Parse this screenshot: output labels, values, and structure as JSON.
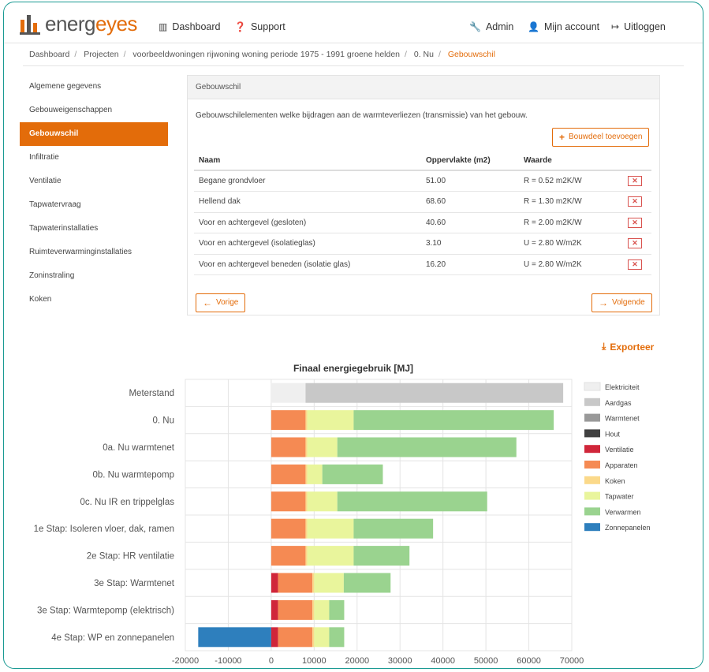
{
  "nav": {
    "logo_part1": "energ",
    "logo_part2": "eyes",
    "dashboard": "Dashboard",
    "support": "Support",
    "admin": "Admin",
    "account": "Mijn account",
    "logout": "Uitloggen"
  },
  "breadcrumb": {
    "items": [
      "Dashboard",
      "Projecten",
      "voorbeeldwoningen rijwoning woning periode 1975 - 1991 groene helden",
      "0. Nu"
    ],
    "active": "Gebouwschil"
  },
  "sidebar": {
    "items": [
      {
        "label": "Algemene gegevens"
      },
      {
        "label": "Gebouweigenschappen"
      },
      {
        "label": "Gebouwschil",
        "active": true
      },
      {
        "label": "Infiltratie"
      },
      {
        "label": "Ventilatie"
      },
      {
        "label": "Tapwatervraag"
      },
      {
        "label": "Tapwaterinstallaties"
      },
      {
        "label": "Ruimteverwarminginstallaties"
      },
      {
        "label": "Zoninstraling"
      },
      {
        "label": "Koken"
      }
    ]
  },
  "panel": {
    "title": "Gebouwschil",
    "description": "Gebouwschilelementen welke bijdragen aan de warmteverliezen (transmissie) van het gebouw.",
    "add_button": "Bouwdeel toevoegen",
    "columns": [
      "Naam",
      "Oppervlakte (m2)",
      "Waarde"
    ],
    "rows": [
      {
        "name": "Begane grondvloer",
        "area": "51.00",
        "value": "R = 0.52 m2K/W"
      },
      {
        "name": "Hellend dak",
        "area": "68.60",
        "value": "R = 1.30 m2K/W"
      },
      {
        "name": "Voor en achtergevel (gesloten)",
        "area": "40.60",
        "value": "R = 2.00 m2K/W"
      },
      {
        "name": "Voor en achtergevel (isolatieglas)",
        "area": "3.10",
        "value": "U = 2.80 W/m2K"
      },
      {
        "name": "Voor en achtergevel beneden (isolatie glas)",
        "area": "16.20",
        "value": "U = 2.80 W/m2K"
      }
    ],
    "delete_glyph": "✕",
    "prev_button": "Vorige",
    "next_button": "Volgende"
  },
  "export_label": "Exporteer",
  "chart_data": {
    "type": "bar",
    "orientation": "horizontal",
    "stacked": true,
    "title": "Finaal energiegebruik [MJ]",
    "xlim": [
      -20000,
      70000
    ],
    "xticks": [
      -20000,
      -10000,
      0,
      10000,
      20000,
      30000,
      40000,
      50000,
      60000,
      70000
    ],
    "grid": true,
    "legend_position": "right",
    "categories": [
      "Meterstand",
      "0. Nu",
      "0a. Nu warmtenet",
      "0b. Nu warmtepomp",
      "0c. Nu IR en  trippelglas",
      "1e Stap: Isoleren  vloer, dak, ramen",
      "2e Stap: HR  ventilatie",
      "3e Stap: Warmtenet",
      "3e Stap: Warmtepomp  (elektrisch)",
      "4e Stap: WP en  zonnepanelen"
    ],
    "series": [
      {
        "name": "Elektriciteit",
        "color": "#efefef",
        "values": [
          8000,
          0,
          0,
          0,
          0,
          0,
          0,
          0,
          0,
          0
        ]
      },
      {
        "name": "Aardgas",
        "color": "#c8c8c8",
        "values": [
          60000,
          0,
          0,
          0,
          0,
          0,
          0,
          0,
          0,
          0
        ]
      },
      {
        "name": "Warmtenet",
        "color": "#999999",
        "values": [
          0,
          0,
          0,
          0,
          0,
          0,
          0,
          0,
          0,
          0
        ]
      },
      {
        "name": "Hout",
        "color": "#404040",
        "values": [
          0,
          0,
          0,
          0,
          0,
          0,
          0,
          0,
          0,
          0
        ]
      },
      {
        "name": "Ventilatie",
        "color": "#d0263a",
        "values": [
          0,
          0,
          0,
          0,
          0,
          0,
          0,
          1600,
          1600,
          1600
        ]
      },
      {
        "name": "Apparaten",
        "color": "#f58a53",
        "values": [
          0,
          8000,
          8000,
          8000,
          8000,
          8000,
          8000,
          8000,
          8000,
          8000
        ]
      },
      {
        "name": "Koken",
        "color": "#fbd98a",
        "values": [
          0,
          400,
          400,
          400,
          400,
          400,
          400,
          400,
          400,
          400
        ]
      },
      {
        "name": "Tapwater",
        "color": "#e9f59c",
        "values": [
          0,
          10800,
          7000,
          3500,
          7000,
          10800,
          10800,
          6900,
          3500,
          3500
        ]
      },
      {
        "name": "Verwarmen",
        "color": "#9ad38f",
        "values": [
          0,
          46600,
          41700,
          14100,
          34900,
          18500,
          13000,
          10900,
          3500,
          3500
        ]
      },
      {
        "name": "Zonnepanelen",
        "color": "#2e7fbd",
        "values": [
          0,
          0,
          0,
          0,
          0,
          0,
          0,
          0,
          0,
          -17000
        ]
      }
    ]
  }
}
